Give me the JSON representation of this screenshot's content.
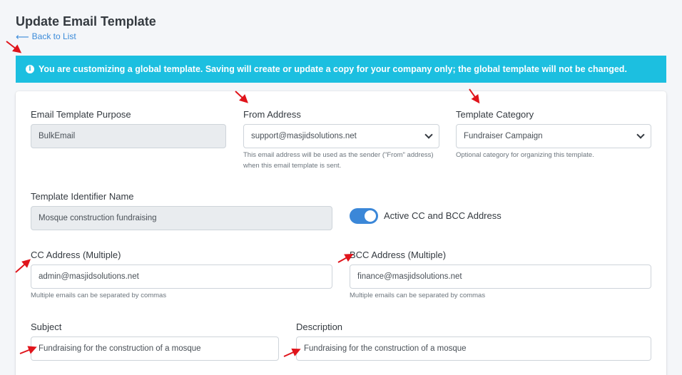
{
  "header": {
    "title": "Update Email Template",
    "back_link": "Back to List"
  },
  "alert": {
    "text": "You are customizing a global template. Saving will create or update a copy for your company only; the global template will not be changed."
  },
  "form": {
    "purpose": {
      "label": "Email Template Purpose",
      "value": "BulkEmail"
    },
    "from_address": {
      "label": "From Address",
      "value": "support@masjidsolutions.net",
      "help_line1": "This email address will be used as the sender (\"From\" address)",
      "help_line2": "when this email template is sent."
    },
    "category": {
      "label": "Template Category",
      "value": "Fundraiser Campaign",
      "help": "Optional category for organizing this template."
    },
    "identifier": {
      "label": "Template Identifier Name",
      "value": "Mosque construction fundraising"
    },
    "active_cc_bcc": {
      "label": "Active CC and BCC Address",
      "on": true
    },
    "cc": {
      "label": "CC Address (Multiple)",
      "value": "admin@masjidsolutions.net",
      "help": "Multiple emails can be separated by commas"
    },
    "bcc": {
      "label": "BCC Address (Multiple)",
      "value": "finance@masjidsolutions.net",
      "help": "Multiple emails can be separated by commas"
    },
    "subject": {
      "label": "Subject",
      "value": "Fundraising for the construction of a mosque"
    },
    "description": {
      "label": "Description",
      "value": "Fundraising for the construction of a mosque"
    }
  },
  "colors": {
    "alert_bg": "#1cbfe0",
    "link": "#3b8bd9",
    "toggle_on": "#3b87d8",
    "annotation_arrow": "#e0141b"
  }
}
